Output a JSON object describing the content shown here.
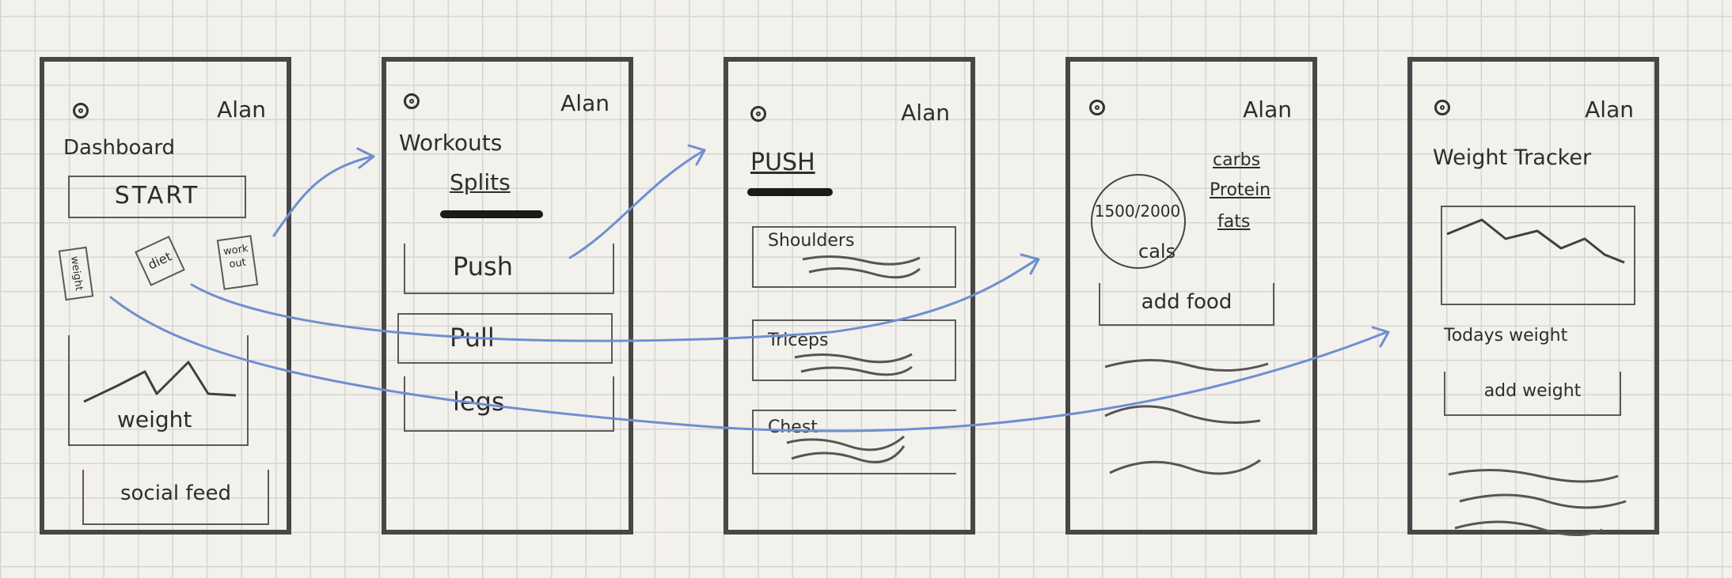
{
  "colors": {
    "ink": "#2d2d2d",
    "frame": "#474747",
    "arrow": "#6e8fd0",
    "paper": "#f3f1ec",
    "grid": "#d5d5d3"
  },
  "screens": [
    {
      "user": "Alan",
      "title": "Dashboard",
      "start_button": "START",
      "tiles": [
        "weight",
        "diet",
        "work out"
      ],
      "chart_label": "weight",
      "feed_button": "social feed"
    },
    {
      "user": "Alan",
      "title": "Workouts",
      "subtitle": "Splits",
      "items": [
        "Push",
        "Pull",
        "legs"
      ]
    },
    {
      "user": "Alan",
      "title": "PUSH",
      "items": [
        "Shoulders",
        "Triceps",
        "Chest"
      ]
    },
    {
      "user": "Alan",
      "calories": "1500/2000",
      "calories_unit": "cals",
      "macros": [
        "carbs",
        "Protein",
        "fats"
      ],
      "add_button": "add food"
    },
    {
      "user": "Alan",
      "title": "Weight Tracker",
      "today_label": "Todays weight",
      "add_button": "add weight"
    }
  ],
  "icons": [
    "avatar-icon"
  ]
}
